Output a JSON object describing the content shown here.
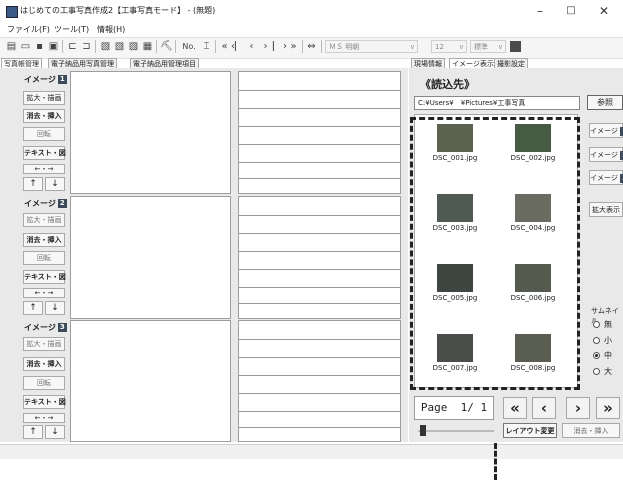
{
  "window": {
    "title": "はじめての工事写真作成2【工事写真モード】 - (無題)",
    "minimize": "–",
    "maximize": "□",
    "close": "✕"
  },
  "menu": [
    {
      "label": "ファイル(F)"
    },
    {
      "label": "ツール(T)"
    },
    {
      "label": "情報(H)"
    }
  ],
  "toolbar": {
    "no_label": "No.",
    "font_name": "ＭＳ 明朝",
    "font_size": "12",
    "font_style": "標準"
  },
  "left_tabs": [
    "写真帳管理",
    "電子納品用写真管理",
    "電子納品用管理項目"
  ],
  "right_tabs": [
    "現場情報",
    "イメージ表示",
    "撮影設定"
  ],
  "image_slots": [
    {
      "label": "イメージ",
      "number": "1",
      "buttons": [
        "拡大・描画",
        "消去・挿入",
        "回転",
        "テキスト・図",
        "←・→"
      ],
      "up": "↑",
      "down": "↓"
    },
    {
      "label": "イメージ",
      "number": "2",
      "buttons": [
        "拡大・描画",
        "消去・挿入",
        "回転",
        "テキスト・図",
        "←・→"
      ],
      "up": "↑",
      "down": "↓"
    },
    {
      "label": "イメージ",
      "number": "3",
      "buttons": [
        "拡大・描画",
        "消去・挿入",
        "回転",
        "テキスト・図",
        "←・→"
      ],
      "up": "↑",
      "down": "↓"
    }
  ],
  "read_source": {
    "heading": "《読込先》",
    "path": "C:¥Users¥　¥Pictures¥工事写真",
    "browse_label": "参照"
  },
  "thumbnails": [
    {
      "name": "DSC_001.jpg"
    },
    {
      "name": "DSC_002.jpg"
    },
    {
      "name": "DSC_003.jpg"
    },
    {
      "name": "DSC_004.jpg"
    },
    {
      "name": "DSC_005.jpg"
    },
    {
      "name": "DSC_006.jpg"
    },
    {
      "name": "DSC_007.jpg"
    },
    {
      "name": "DSC_008.jpg"
    }
  ],
  "side_buttons": [
    {
      "label": "イメージ",
      "number": "1"
    },
    {
      "label": "イメージ",
      "number": "2"
    },
    {
      "label": "イメージ",
      "number": "3"
    }
  ],
  "enlarge_label": "拡大表示",
  "thumbnail_size": {
    "label": "サムネイル",
    "options": [
      "無",
      "小",
      "中",
      "大"
    ],
    "selected": "中"
  },
  "pager": {
    "text": "Page  1/ 1",
    "first": "«",
    "prev": "‹",
    "next": "›",
    "last": "»",
    "slider_value": 0
  },
  "layout_change_label": "レイアウト変更",
  "erase_insert_label": "消去・挿入"
}
